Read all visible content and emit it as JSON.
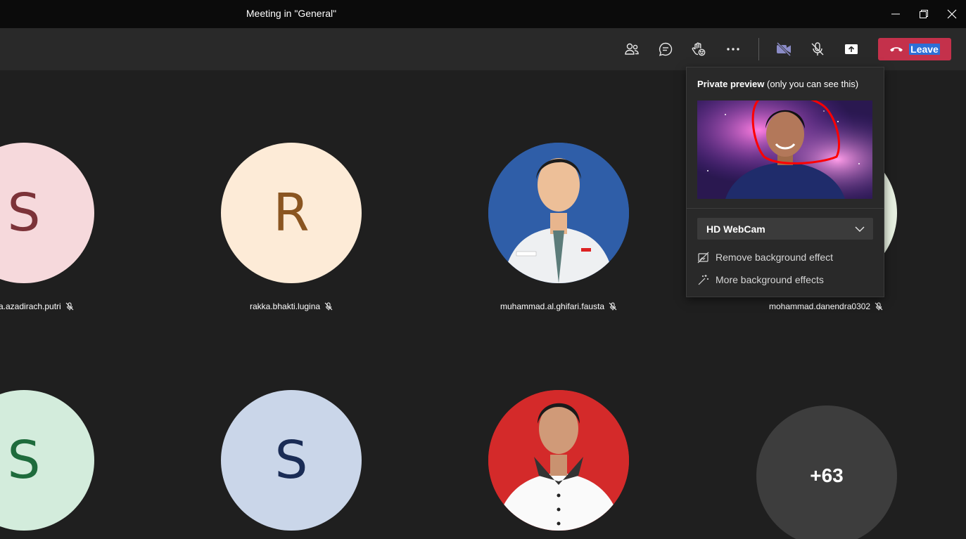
{
  "window": {
    "title": "Meeting in \"General\"",
    "controls": [
      "minimize-icon",
      "restore-icon",
      "close-icon"
    ]
  },
  "toolbar": {
    "buttons": [
      "people-icon",
      "chat-icon",
      "raise-hand-icon",
      "more-options-icon",
      "camera-icon",
      "mic-off-icon",
      "share-tray-icon"
    ],
    "leave_label": "Leave",
    "leave_color": "#c4314b"
  },
  "participants": [
    {
      "name": "a.azadirach.putri",
      "initial": "S",
      "bg": "#f6d9dc",
      "fg": "#7c3339",
      "muted": true
    },
    {
      "name": "rakka.bhakti.lugina",
      "initial": "R",
      "bg": "#fdebd7",
      "fg": "#8a5521",
      "muted": true
    },
    {
      "name": "muhammad.al.ghifari.fausta",
      "initial": "",
      "photo": true,
      "photo_bg": "#2f5ea8",
      "muted": true
    },
    {
      "name": "mohammad.danendra0302",
      "initial": "",
      "muted": true
    },
    {
      "name": "",
      "initial": "S",
      "bg": "#d3ecdc",
      "fg": "#1e6b3c"
    },
    {
      "name": "",
      "initial": "S",
      "bg": "#cad6e9",
      "fg": "#1a2c55"
    },
    {
      "name": "",
      "initial": "",
      "photo": true,
      "photo_bg": "#d42a2a"
    }
  ],
  "overflow_count": "+63",
  "preview_panel": {
    "title_bold": "Private preview",
    "title_rest": " (only you can see this)",
    "camera": "HD WebCam",
    "remove_label": "Remove background effect",
    "more_label": "More background effects"
  }
}
